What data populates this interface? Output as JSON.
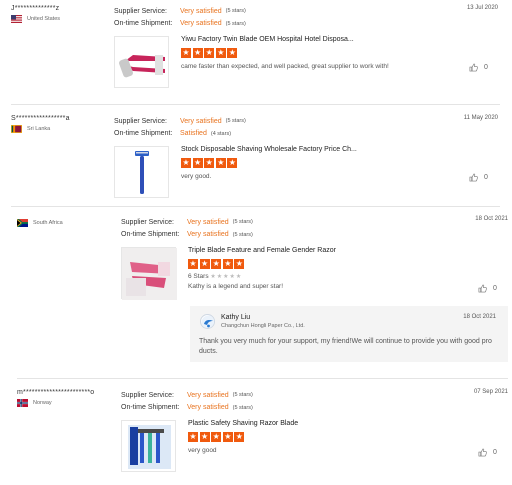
{
  "reviews": [
    {
      "buyer": "J**************z",
      "country": "United States",
      "flag": "us-flag-icon",
      "supplier_service_label": "Supplier Service:",
      "supplier_service_value": "Very satisfied",
      "supplier_service_stars": "(5 stars)",
      "shipment_label": "On-time Shipment:",
      "shipment_value": "Very satisfied",
      "shipment_stars": "(5 stars)",
      "date": "13 Jul 2020",
      "product_title": "Yiwu Factory Twin Blade OEM Hospital Hotel Disposa...",
      "rating": 5,
      "comment": "came faster than expected, and well packed, great supplier to work with!",
      "likes": "0"
    },
    {
      "buyer": "S*****************a",
      "country": "Sri Lanka",
      "flag": "sri-lanka-flag-icon",
      "supplier_service_label": "Supplier Service:",
      "supplier_service_value": "Very satisfied",
      "supplier_service_stars": "(5 stars)",
      "shipment_label": "On-time Shipment:",
      "shipment_value": "Satisfied",
      "shipment_stars": "(4 stars)",
      "date": "11 May 2020",
      "product_title": "Stock Disposable Shaving Wholesale Factory Price Ch...",
      "rating": 5,
      "comment": "very good.",
      "likes": "0"
    },
    {
      "buyer": "",
      "country": "South Africa",
      "flag": "south-africa-flag-icon",
      "supplier_service_label": "Supplier Service:",
      "supplier_service_value": "Very satisfied",
      "supplier_service_stars": "(5 stars)",
      "shipment_label": "On-time Shipment:",
      "shipment_value": "Very satisfied",
      "shipment_stars": "(5 stars)",
      "date": "18 Oct 2021",
      "product_title": "Triple Blade Feature and Female Gender Razor",
      "rating": 5,
      "sub_rating_label": "6 Stars",
      "comment": "Kathy is a legend and super star!",
      "likes": "0",
      "reply": {
        "name": "Kathy Liu",
        "company": "Changchun Hongli Paper Co., Ltd.",
        "date": "18 Oct 2021",
        "text": "Thank you very much for your support, my friend!We will continue to provide you with good pro ducts."
      }
    },
    {
      "buyer": "m***********************o",
      "country": "Norway",
      "flag": "norway-flag-icon",
      "supplier_service_label": "Supplier Service:",
      "supplier_service_value": "Very satisfied",
      "supplier_service_stars": "(5 stars)",
      "shipment_label": "On-time Shipment:",
      "shipment_value": "Very satisfied",
      "shipment_stars": "(5 stars)",
      "date": "07 Sep 2021",
      "product_title": "Plastic Safety Shaving Razor Blade",
      "rating": 5,
      "comment": "very good",
      "likes": "0"
    }
  ],
  "colors": {
    "accent": "#e8731f",
    "star": "#f05a0e",
    "divider": "#e4e4e4",
    "reply_bg": "#f4f4f4"
  }
}
